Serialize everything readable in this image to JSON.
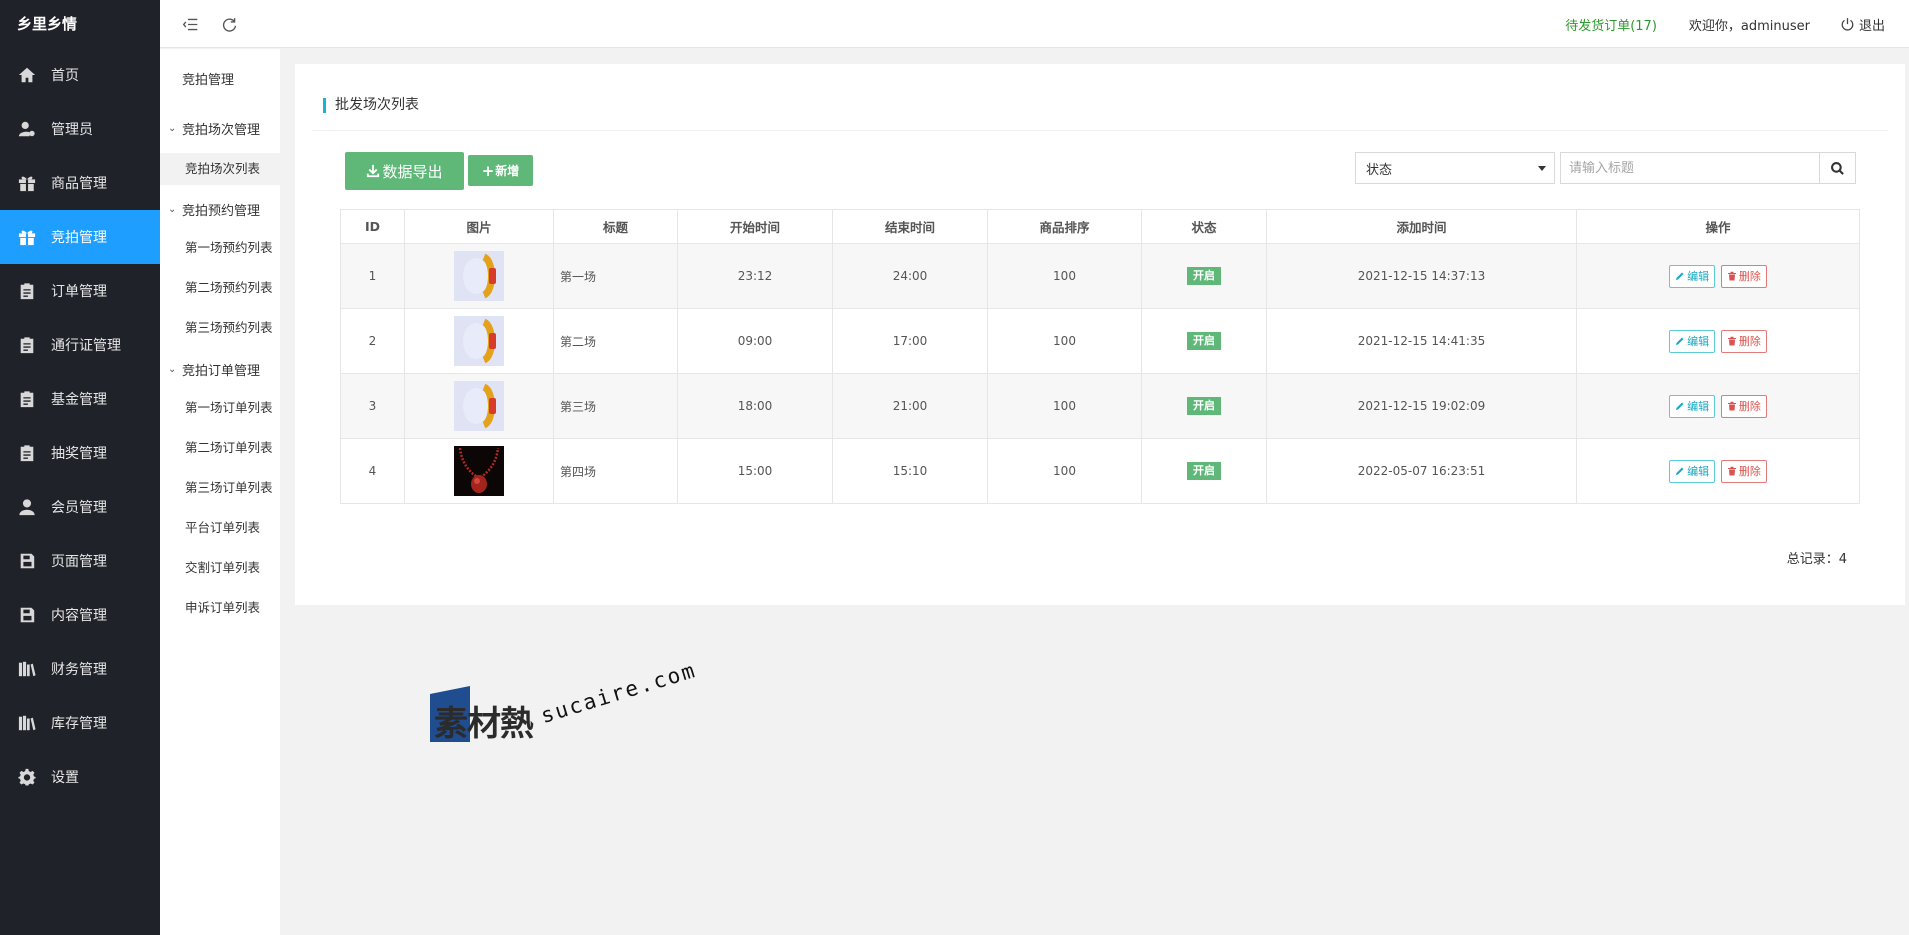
{
  "brand": "乡里乡情",
  "sidebar": {
    "items": [
      {
        "label": "首页",
        "icon": "home-icon"
      },
      {
        "label": "管理员",
        "icon": "user-gear-icon"
      },
      {
        "label": "商品管理",
        "icon": "gift-icon"
      },
      {
        "label": "竞拍管理",
        "icon": "gift-icon",
        "active": true
      },
      {
        "label": "订单管理",
        "icon": "clipboard-icon"
      },
      {
        "label": "通行证管理",
        "icon": "clipboard-icon"
      },
      {
        "label": "基金管理",
        "icon": "clipboard-icon"
      },
      {
        "label": "抽奖管理",
        "icon": "clipboard-icon"
      },
      {
        "label": "会员管理",
        "icon": "user-icon"
      },
      {
        "label": "页面管理",
        "icon": "save-icon"
      },
      {
        "label": "内容管理",
        "icon": "save-icon"
      },
      {
        "label": "财务管理",
        "icon": "books-icon"
      },
      {
        "label": "库存管理",
        "icon": "books-icon"
      },
      {
        "label": "设置",
        "icon": "gear-icon"
      }
    ]
  },
  "header": {
    "pending_label": "待发货订单(17)",
    "welcome": "欢迎你，adminuser",
    "logout": "退出"
  },
  "subnav": {
    "title": "竞拍管理",
    "group1": "竞拍场次管理",
    "g1_item1": "竞拍场次列表",
    "group2": "竞拍预约管理",
    "g2_item1": "第一场预约列表",
    "g2_item2": "第二场预约列表",
    "g2_item3": "第三场预约列表",
    "group3": "竞拍订单管理",
    "g3_item1": "第一场订单列表",
    "g3_item2": "第二场订单列表",
    "g3_item3": "第三场订单列表",
    "g3_item4": "平台订单列表",
    "g3_item5": "交割订单列表",
    "g3_item6": "申诉订单列表"
  },
  "main": {
    "title": "批发场次列表",
    "export_label": "数据导出",
    "add_label": "新增",
    "status_select": "状态",
    "search_placeholder": "请输入标题",
    "columns": [
      "ID",
      "图片",
      "标题",
      "开始时间",
      "结束时间",
      "商品排序",
      "状态",
      "添加时间",
      "操作"
    ],
    "rows": [
      {
        "id": "1",
        "image": "bracelet-thumbnail",
        "title": "第一场",
        "start": "23:12",
        "end": "24:00",
        "sort": "100",
        "status": "开启",
        "added": "2021-12-15 14:37:13"
      },
      {
        "id": "2",
        "image": "bracelet-thumbnail",
        "title": "第二场",
        "start": "09:00",
        "end": "17:00",
        "sort": "100",
        "status": "开启",
        "added": "2021-12-15 14:41:35"
      },
      {
        "id": "3",
        "image": "bracelet-thumbnail",
        "title": "第三场",
        "start": "18:00",
        "end": "21:00",
        "sort": "100",
        "status": "开启",
        "added": "2021-12-15 19:02:09"
      },
      {
        "id": "4",
        "image": "necklace-thumbnail",
        "title": "第四场",
        "start": "15:00",
        "end": "15:10",
        "sort": "100",
        "status": "开启",
        "added": "2022-05-07 16:23:51"
      }
    ],
    "edit_label": "编辑",
    "delete_label": "删除",
    "total": "总记录：4"
  },
  "watermark": {
    "cn": "素材熱",
    "en": "sucaire.com"
  },
  "colors": {
    "sidebar_bg": "#20222a",
    "active": "#1e9fff",
    "green": "#5fb878",
    "accent_bar": "#18b4d1"
  }
}
